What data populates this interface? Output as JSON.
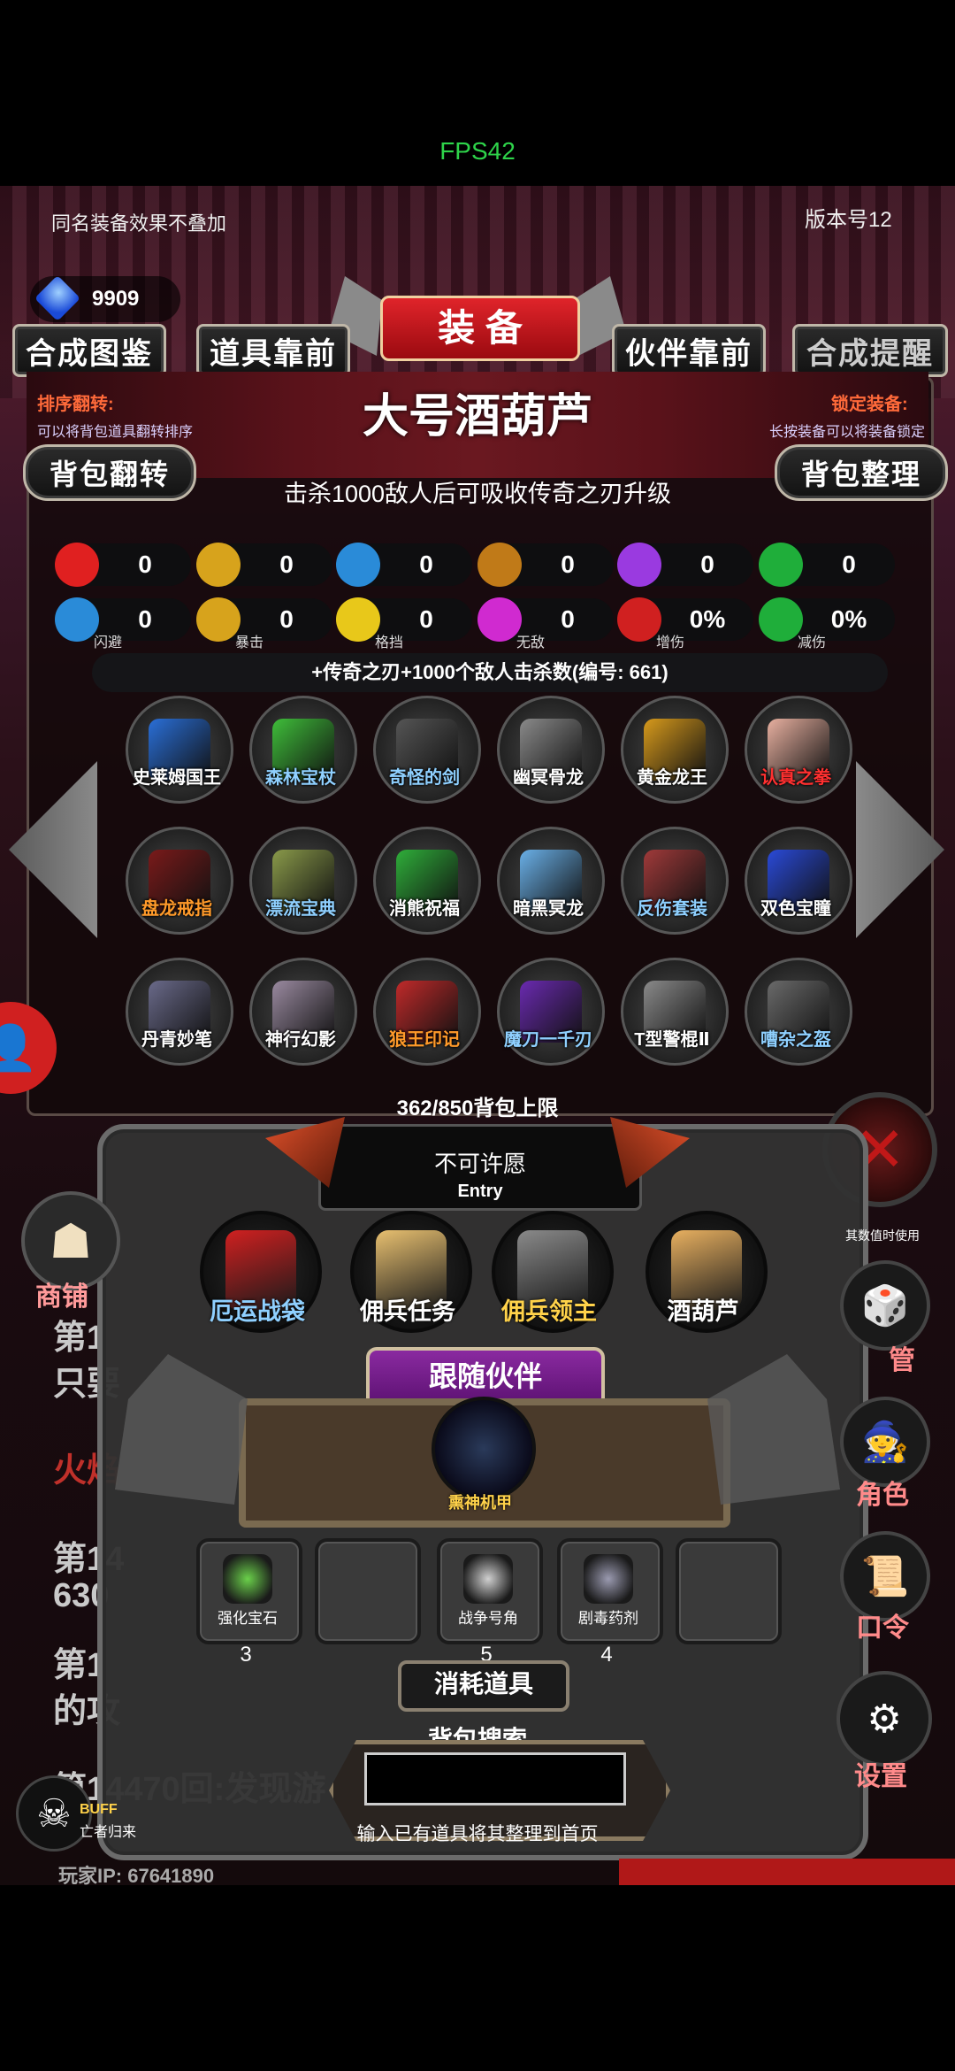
{
  "status": {
    "fps": "FPS42"
  },
  "header": {
    "note_left": "同名装备效果不叠加",
    "version": "版本号12",
    "gems": "9909",
    "banner": "装 备"
  },
  "tabs": [
    "合成图鉴",
    "道具靠前",
    "伙伴靠前",
    "合成提醒"
  ],
  "info": {
    "sort_title": "排序翻转:",
    "sort_desc": "可以将背包道具翻转排序",
    "lock_title": "锁定装备:",
    "lock_desc": "长按装备可以将装备锁定",
    "item_name": "大号酒葫芦",
    "item_desc": "击杀1000敌人后可吸收传奇之刃升级",
    "btn_flip": "背包翻转",
    "btn_sort": "背包整理"
  },
  "stats_row1": [
    {
      "icon": "heart-icon",
      "value": "0",
      "color": "#e02020"
    },
    {
      "icon": "strength-icon",
      "value": "0",
      "color": "#d7a31c"
    },
    {
      "icon": "helmet-icon",
      "value": "0",
      "color": "#2a8bd8"
    },
    {
      "icon": "sword-icon",
      "value": "0",
      "color": "#c07a18"
    },
    {
      "icon": "lightning-icon",
      "value": "0",
      "color": "#9a3ae0"
    },
    {
      "icon": "clover-icon",
      "value": "0",
      "color": "#1fae3a"
    }
  ],
  "stats_row2": [
    {
      "icon": "dodge-icon",
      "value": "0",
      "label": "闪避",
      "color": "#2a8bd8"
    },
    {
      "icon": "crit-icon",
      "value": "0",
      "label": "暴击",
      "color": "#d7a31c"
    },
    {
      "icon": "block-icon",
      "value": "0",
      "label": "格挡",
      "color": "#e8c81a"
    },
    {
      "icon": "invincible-icon",
      "value": "0",
      "label": "无敌",
      "color": "#d02ad0"
    },
    {
      "icon": "damage-up-icon",
      "value": "0%",
      "label": "增伤",
      "color": "#d02020"
    },
    {
      "icon": "damage-reduce-icon",
      "value": "0%",
      "label": "减伤",
      "color": "#1fae3a"
    }
  ],
  "effect": "+传奇之刃+1000个敌人击杀数(编号: 661)",
  "items": [
    {
      "name": "史莱姆国王",
      "color": "#ffffff",
      "tint": "#2a6fd8"
    },
    {
      "name": "森林宝杖",
      "color": "#8fd0ff",
      "tint": "#3fbe3a"
    },
    {
      "name": "奇怪的剑",
      "color": "#8fd0ff",
      "tint": "#555555"
    },
    {
      "name": "幽冥骨龙",
      "color": "#ffffff",
      "tint": "#8a8a8a"
    },
    {
      "name": "黄金龙王",
      "color": "#ffffff",
      "tint": "#d79a1c"
    },
    {
      "name": "认真之拳",
      "color": "#ff3030",
      "tint": "#e8b0a0"
    },
    {
      "name": "盘龙戒指",
      "color": "#ff9a2a",
      "tint": "#7a1a1a"
    },
    {
      "name": "漂流宝典",
      "color": "#8fd0ff",
      "tint": "#8a9a4a"
    },
    {
      "name": "消熊祝福",
      "color": "#ffffff",
      "tint": "#2fae3a"
    },
    {
      "name": "暗黑冥龙",
      "color": "#ffffff",
      "tint": "#6ab0e8"
    },
    {
      "name": "反伤套装",
      "color": "#8fd0ff",
      "tint": "#a03a3a"
    },
    {
      "name": "双色宝瞳",
      "color": "#ffffff",
      "tint": "#2a4ad8"
    },
    {
      "name": "丹青妙笔",
      "color": "#ffffff",
      "tint": "#6a6a8a"
    },
    {
      "name": "神行幻影",
      "color": "#ffffff",
      "tint": "#9a8aa0"
    },
    {
      "name": "狼王印记",
      "color": "#ff9a2a",
      "tint": "#c02a2a"
    },
    {
      "name": "魔刀一千刃",
      "color": "#8fd0ff",
      "tint": "#6a2ab0"
    },
    {
      "name": "T型警棍Ⅱ",
      "color": "#ffffff",
      "tint": "#8a8a8a"
    },
    {
      "name": "嘈杂之盔",
      "color": "#8fd0ff",
      "tint": "#6a6a6a"
    }
  ],
  "capacity": "362/850背包上限",
  "wish": {
    "title": "不可许愿",
    "sub": "Entry"
  },
  "characters": [
    {
      "name": "厄运战袋",
      "color": "#8fd0ff",
      "tint": "#d02020"
    },
    {
      "name": "佣兵任务",
      "color": "#ffffff",
      "tint": "#e8c070"
    },
    {
      "name": "佣兵领主",
      "color": "#ffd24a",
      "tint": "#8a8a8a"
    },
    {
      "name": "酒葫芦",
      "color": "#ffffff",
      "tint": "#e8b060"
    }
  ],
  "companion": {
    "title": "跟随伙伴",
    "name": "熏神机甲"
  },
  "consumables": {
    "title": "消耗道具",
    "slots": [
      {
        "name": "强化宝石",
        "count": "3",
        "tint": "#6ad04a"
      },
      {
        "name": "",
        "count": "",
        "tint": ""
      },
      {
        "name": "战争号角",
        "count": "5",
        "tint": "#d0d0d0"
      },
      {
        "name": "剧毒药剂",
        "count": "4",
        "tint": "#9a9ab0"
      },
      {
        "name": "",
        "count": "",
        "tint": ""
      }
    ]
  },
  "search": {
    "title": "背包搜索",
    "placeholder": "",
    "hint": "输入已有道具将其整理到首页"
  },
  "side_left": {
    "shop": "商铺",
    "buff": "BUFF",
    "buff_desc": "亡者归来"
  },
  "side_right": {
    "manage": "管",
    "role": "角色",
    "code": "口令",
    "settings": "设置",
    "count_text": "其数值时使用"
  },
  "log": [
    "第1",
    "只要",
    "火焰",
    "第14",
    "630",
    "第1",
    "的攻",
    "第14470回:发现游"
  ],
  "player": {
    "ip": "玩家IP:  67641890"
  }
}
